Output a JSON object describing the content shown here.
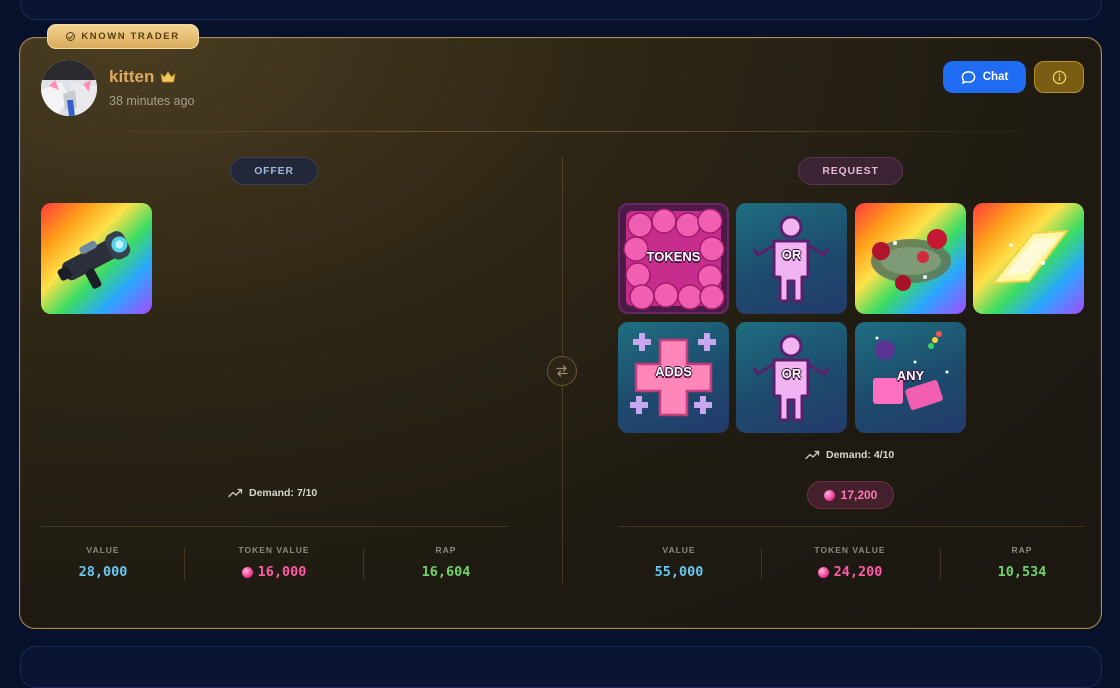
{
  "badge": {
    "label": "KNOWN TRADER",
    "icon": "check-circle-icon"
  },
  "user": {
    "name": "kitten",
    "crown_icon": "crown-icon",
    "time_ago": "38 minutes ago"
  },
  "actions": {
    "chat_label": "Chat",
    "chat_icon": "chat-bubble-icon",
    "info_icon": "info-icon"
  },
  "offer": {
    "label": "OFFER",
    "items": [
      {
        "name": "rainbow-blaster-item",
        "background": "rainbow"
      }
    ],
    "demand": "Demand: 7/10",
    "stats": {
      "value_label": "VALUE",
      "value": "28,000",
      "token_label": "TOKEN VALUE",
      "token_value": "16,000",
      "rap_label": "RAP",
      "rap": "16,604"
    }
  },
  "request": {
    "label": "REQUEST",
    "items": [
      {
        "name": "tokens-item",
        "label": "TOKENS"
      },
      {
        "name": "or-placeholder-item",
        "label": "OR"
      },
      {
        "name": "rainbow-rose-wreath-item",
        "background": "rainbow"
      },
      {
        "name": "rainbow-crystal-item",
        "background": "rainbow"
      },
      {
        "name": "adds-item",
        "label": "ADDS"
      },
      {
        "name": "or-placeholder-item-2",
        "label": "OR"
      },
      {
        "name": "any-item",
        "label": "ANY"
      }
    ],
    "demand": "Demand: 4/10",
    "token_amount": "17,200",
    "stats": {
      "value_label": "VALUE",
      "value": "55,000",
      "token_label": "TOKEN VALUE",
      "token_value": "24,200",
      "rap_label": "RAP",
      "rap": "10,534"
    }
  },
  "colors": {
    "accent_gold": "#e3a95a",
    "chat_blue": "#1f6bf2",
    "value_blue": "#66c9f2",
    "token_pink": "#ff5aa7",
    "rap_green": "#6fd46a"
  }
}
